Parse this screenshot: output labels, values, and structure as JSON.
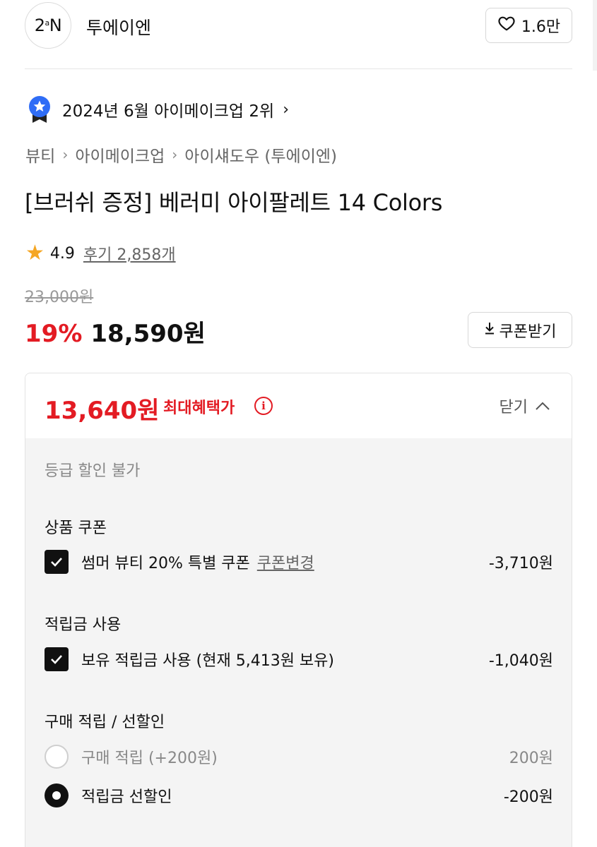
{
  "brand": {
    "logo_text": "2N",
    "logo_sup": "a",
    "name": "투에이엔",
    "like_count": "1.6만"
  },
  "ranking": {
    "text": "2024년 6월 아이메이크업 2위",
    "chevron": "›"
  },
  "breadcrumb": [
    "뷰티",
    "아이메이크업",
    "아이섀도우 (투에이엔)"
  ],
  "breadcrumb_sep": "›",
  "product": {
    "title": "[브러쉬 증정] 베러미 아이팔레트 14 Colors",
    "rating": "4.9",
    "review_text": "후기 2,858개",
    "original_price": "23,000원",
    "discount_rate": "19%",
    "sale_price": "18,590원",
    "coupon_button": "쿠폰받기"
  },
  "benefit": {
    "max_price": "13,640원",
    "max_label": "최대혜택가",
    "info_glyph": "i",
    "toggle_label": "닫기",
    "grade_note": "등급 할인 불가",
    "sections": {
      "coupon": {
        "title": "상품 쿠폰",
        "item_text": "썸머 뷰티 20% 특별 쿠폰",
        "item_link": "쿠폰변경",
        "item_amount": "-3,710원"
      },
      "points": {
        "title": "적립금 사용",
        "item_text": "보유 적립금 사용 (현재 5,413원 보유)",
        "item_amount": "-1,040원"
      },
      "purchase": {
        "title": "구매 적립 / 선할인",
        "option1_text": "구매 적립 (+200원)",
        "option1_amount": "200원",
        "option2_text": "적립금 선할인",
        "option2_amount": "-200원"
      }
    }
  },
  "colors": {
    "accent_red": "#e31b23",
    "badge_blue": "#2f6df6",
    "star_orange": "#f5a623"
  },
  "icons": [
    "heart-icon",
    "ranking-badge-icon",
    "star-icon",
    "download-icon",
    "info-icon",
    "chevron-up-icon",
    "check-icon"
  ]
}
